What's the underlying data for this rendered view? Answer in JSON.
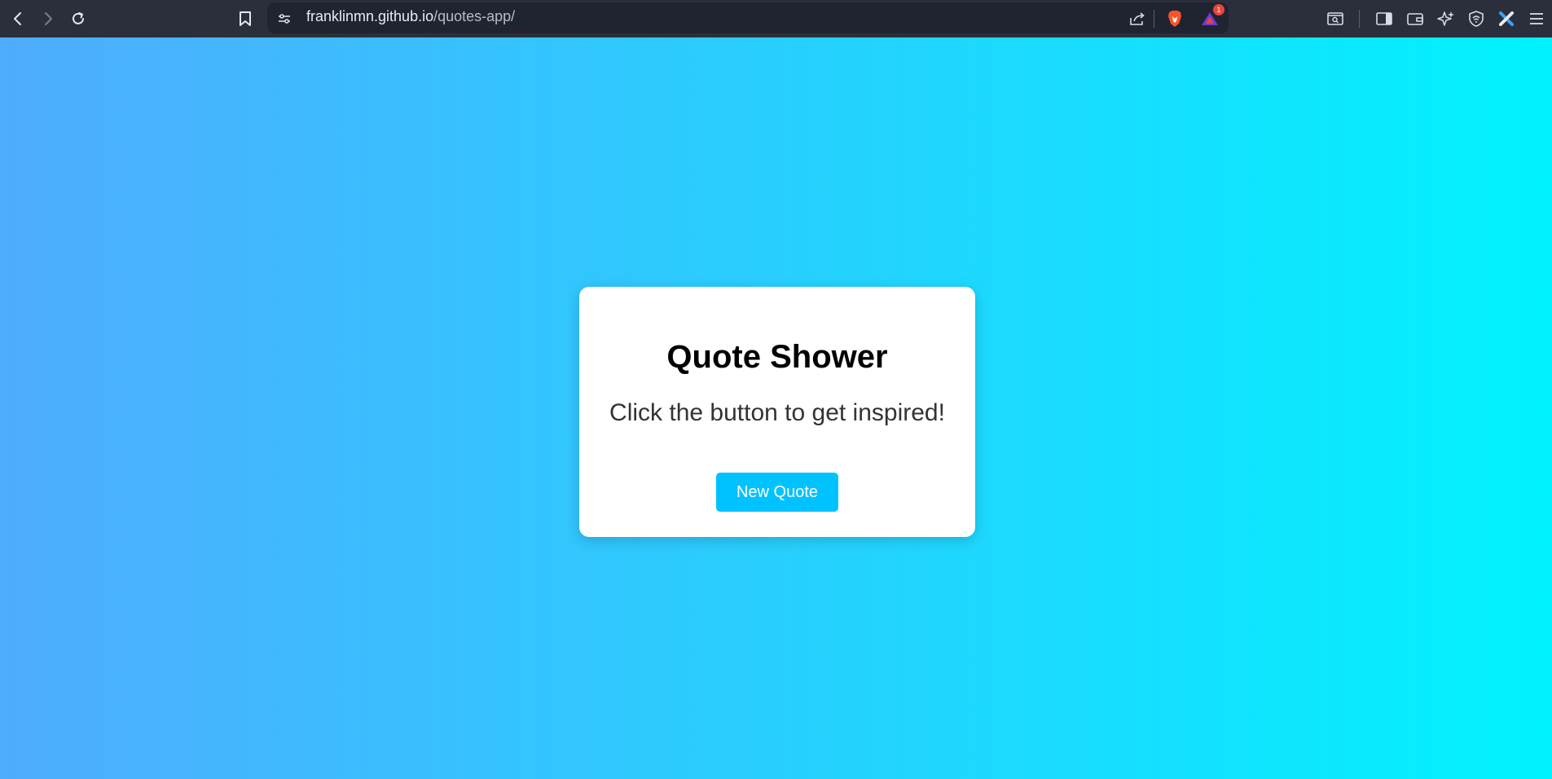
{
  "browser": {
    "url_host": "franklinmn.github.io",
    "url_path": "/quotes-app/",
    "notification_count": "1"
  },
  "card": {
    "title": "Quote Shower",
    "text": "Click the button to get inspired!",
    "button_label": "New Quote"
  },
  "colors": {
    "gradient_start": "#4facfe",
    "gradient_end": "#00f2fe",
    "button": "#00c2ff",
    "toolbar": "#2b2f3b"
  },
  "icons": [
    "back-icon",
    "forward-icon",
    "reload-icon",
    "bookmark-icon",
    "site-settings-icon",
    "share-icon",
    "brave-shield-icon",
    "brave-rewards-icon",
    "tab-search-icon",
    "sidebar-icon",
    "wallet-icon",
    "leo-ai-icon",
    "vpn-icon",
    "extension-icon",
    "menu-icon"
  ]
}
